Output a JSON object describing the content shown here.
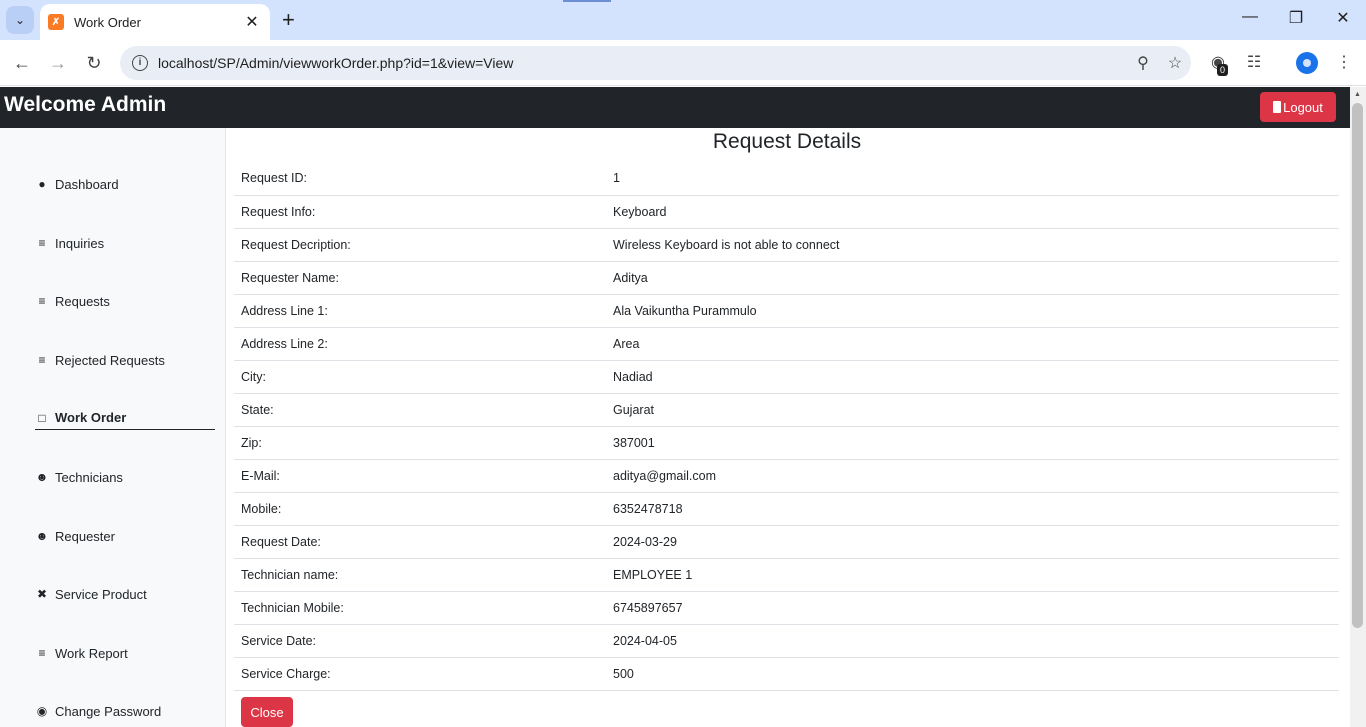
{
  "browser": {
    "tab_title": "Work Order",
    "url": "localhost/SP/Admin/viewworkOrder.php?id=1&view=View",
    "extension_badge": "0"
  },
  "header": {
    "title": "Welcome Admin",
    "logout_label": "Logout"
  },
  "sidebar": {
    "items": [
      {
        "label": "Dashboard",
        "icon": "user-icon"
      },
      {
        "label": "Inquiries",
        "icon": "list-icon"
      },
      {
        "label": "Requests",
        "icon": "list-icon"
      },
      {
        "label": "Rejected Requests",
        "icon": "list-icon"
      },
      {
        "label": "Work Order",
        "icon": "clipboard-icon"
      },
      {
        "label": "Technicians",
        "icon": "users-icon"
      },
      {
        "label": "Requester",
        "icon": "user-group-icon"
      },
      {
        "label": "Service Product",
        "icon": "tools-icon"
      },
      {
        "label": "Work Report",
        "icon": "list-icon"
      },
      {
        "label": "Change Password",
        "icon": "eye-icon"
      }
    ],
    "active": "Work Order"
  },
  "main": {
    "title": "Request Details",
    "rows": [
      {
        "label": "Request ID:",
        "value": "1"
      },
      {
        "label": "Request Info:",
        "value": "Keyboard"
      },
      {
        "label": "Request Decription:",
        "value": "Wireless Keyboard is not able to connect"
      },
      {
        "label": "Requester Name:",
        "value": "Aditya"
      },
      {
        "label": "Address Line 1:",
        "value": "Ala Vaikuntha Purammulo"
      },
      {
        "label": "Address Line 2:",
        "value": "Area"
      },
      {
        "label": "City:",
        "value": "Nadiad"
      },
      {
        "label": "State:",
        "value": "Gujarat"
      },
      {
        "label": "Zip:",
        "value": "387001"
      },
      {
        "label": "E-Mail:",
        "value": "aditya@gmail.com"
      },
      {
        "label": "Mobile:",
        "value": "6352478718"
      },
      {
        "label": "Request Date:",
        "value": "2024-03-29"
      },
      {
        "label": "Technician name:",
        "value": "EMPLOYEE 1"
      },
      {
        "label": "Technician Mobile:",
        "value": "6745897657"
      },
      {
        "label": "Service Date:",
        "value": "2024-04-05"
      },
      {
        "label": "Service Charge:",
        "value": "500"
      }
    ],
    "close_label": "Close"
  },
  "colors": {
    "header_bg": "#212529",
    "danger": "#dc3545",
    "sidebar_bg": "#f8f9fa"
  }
}
